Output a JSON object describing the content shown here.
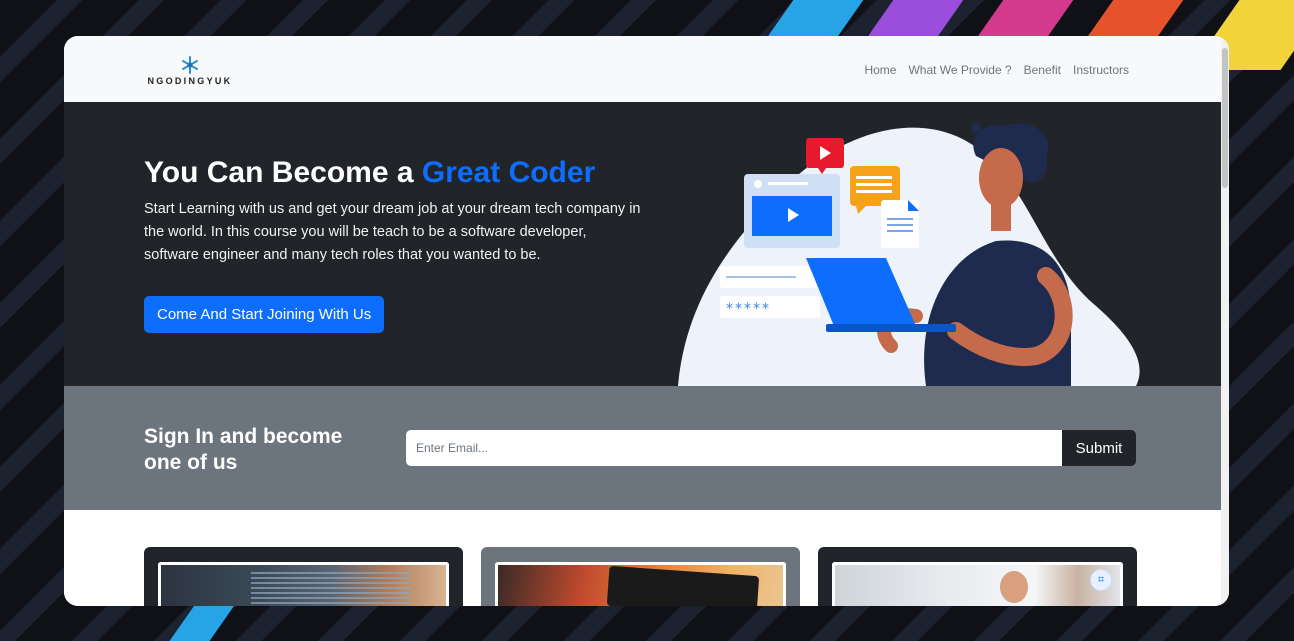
{
  "brand": {
    "name": "NGODINGYUK"
  },
  "nav": {
    "links": [
      "Home",
      "What We Provide ?",
      "Benefit",
      "Instructors"
    ]
  },
  "hero": {
    "title_prefix": "You Can Become a ",
    "title_highlight": "Great Coder",
    "description": "Start Learning with us and get your dream job at your dream tech company in the world. In this course you will be teach to be a software developer, software engineer and many tech roles that you wanted to be.",
    "cta_label": "Come And Start Joining With Us",
    "illustration_password": "*****"
  },
  "signup": {
    "heading": "Sign In and become one of us",
    "email_placeholder": "Enter Email...",
    "submit_label": "Submit"
  },
  "colors": {
    "primary": "#0d6efd",
    "dark": "#212529",
    "secondary": "#6c757d",
    "light": "#f8f9fa"
  },
  "icons": {
    "logo": "snowflake-icon",
    "card_action": "scan-icon"
  }
}
